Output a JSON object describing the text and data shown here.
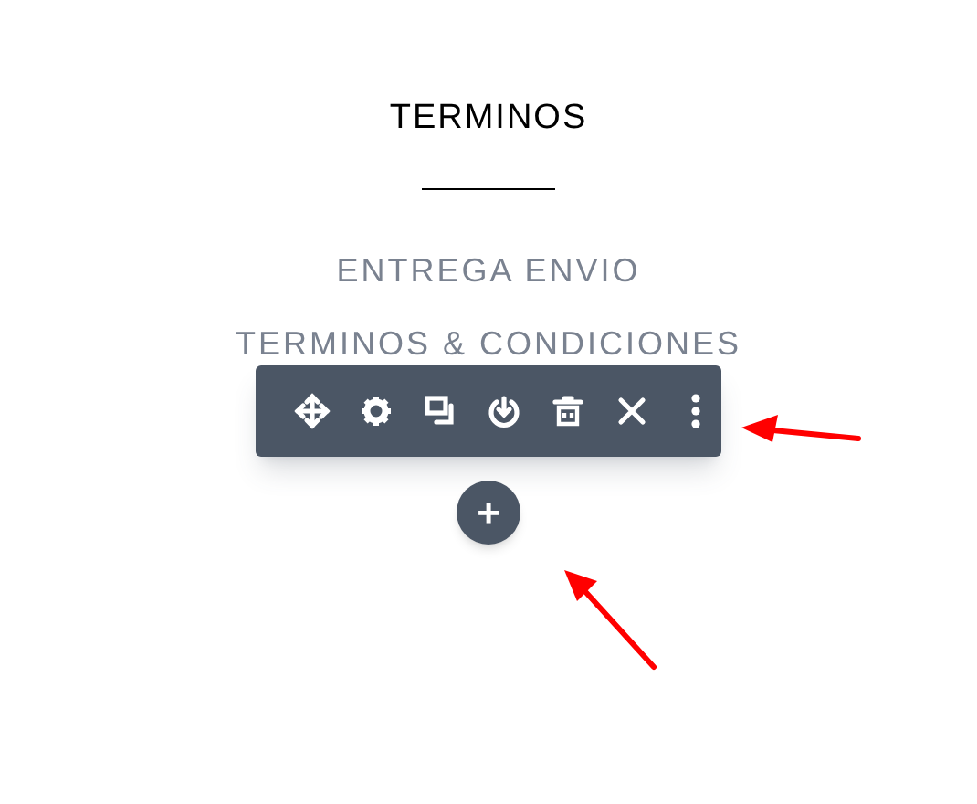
{
  "heading": "TERMINOS",
  "links": [
    "ENTREGA ENVIO",
    "TERMINOS & CONDICIONES"
  ],
  "toolbar": {
    "buttons": [
      {
        "kind": "move"
      },
      {
        "kind": "settings"
      },
      {
        "kind": "duplicate"
      },
      {
        "kind": "save"
      },
      {
        "kind": "delete"
      },
      {
        "kind": "close"
      },
      {
        "kind": "more"
      }
    ]
  },
  "add_button": {
    "label": "+"
  }
}
